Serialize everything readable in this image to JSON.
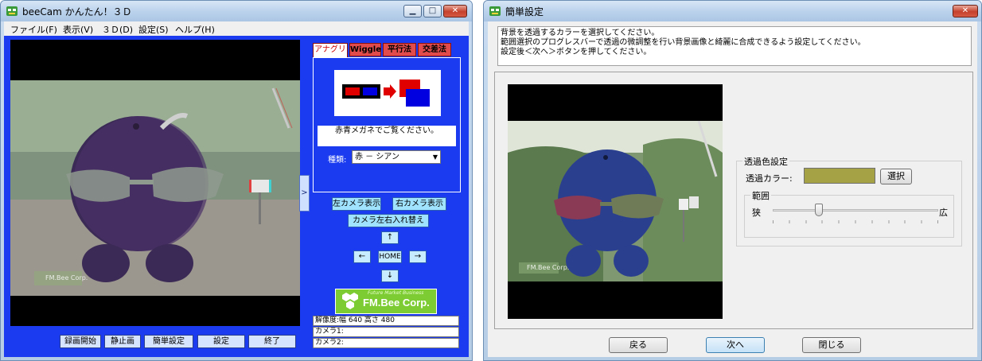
{
  "main_window": {
    "title": "beeCam かんたん！３Ｄ",
    "menu": [
      "ファイル(F)",
      "表示(V)",
      "３Ｄ(D)",
      "設定(S)",
      "ヘルプ(H)"
    ],
    "tabs": [
      "アナグリフ",
      "Wiggle",
      "平行法",
      "交差法"
    ],
    "hint": "赤青メガネでご覧ください。",
    "type_label": "種類:",
    "type_value": "赤 － シアン",
    "left_camera_button": "左カメラ表示",
    "right_camera_button": "右カメラ表示",
    "swap_button": "カメラ左右入れ替え",
    "up_button": "↑",
    "left_button": "←",
    "home_button": "HOME",
    "right_button": "→",
    "down_button": "↓",
    "logo_text": "FM.Bee Corp.",
    "logo_tagline": "Future Market Business",
    "watermark": "FM.Bee Corp.",
    "side_toggle": ">",
    "info": [
      "解像度:幅 640  高さ 480",
      "カメラ1:",
      "カメラ2:"
    ],
    "bottom_buttons": [
      "録画開始",
      "静止画",
      "簡単設定",
      "設定",
      "終了"
    ]
  },
  "dialog": {
    "title": "簡単設定",
    "instructions": [
      "背景を透過するカラーを選択してください。",
      "範囲選択のプログレスバーで透過の微調整を行い背景画像と綺麗に合成できるよう設定してください。",
      "設定後＜次へ＞ボタンを押してください。"
    ],
    "group_title": "透過色設定",
    "color_label": "透過カラー:",
    "color_value": "#a5a145",
    "select_button": "選択",
    "range_title": "範囲",
    "range_min": "狭",
    "range_max": "広",
    "range_level": 0.28,
    "watermark": "FM.Bee Corp.",
    "buttons": [
      "戻る",
      "次へ",
      "閉じる"
    ]
  }
}
